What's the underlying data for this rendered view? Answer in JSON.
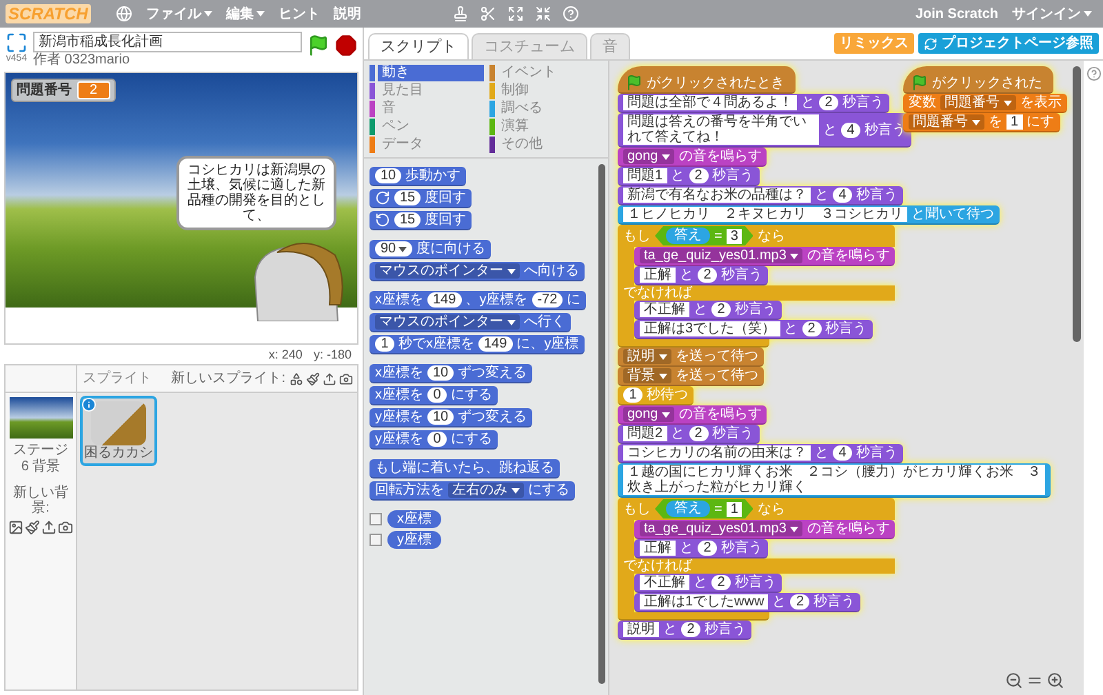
{
  "menu_bar": {
    "logo": "SCRATCH",
    "menus": [
      {
        "label": "ファイル",
        "dropdown": true
      },
      {
        "label": "編集",
        "dropdown": true
      },
      {
        "label": "ヒント",
        "dropdown": false
      },
      {
        "label": "説明",
        "dropdown": false
      }
    ],
    "join": "Join Scratch",
    "sign_in": "サインイン"
  },
  "project": {
    "version": "v454",
    "title": "新潟市稲成長化計画",
    "author": "作者 0323mario"
  },
  "stage": {
    "monitor": {
      "label": "問題番号",
      "value": "2"
    },
    "speech": "コシヒカリは新潟県の土壌、気候に適した新品種の開発を目的として、",
    "x_label": "x:",
    "x_value": "240",
    "y_label": "y:",
    "y_value": "-180"
  },
  "sprites": {
    "title": "スプライト",
    "new_sprite": "新しいスプライト:",
    "stage_label": "ステージ",
    "backdrops": "6 背景",
    "new_backdrop": "新しい背景:",
    "items": [
      {
        "name": "困るカカシ",
        "selected": true
      }
    ]
  },
  "tabs": [
    {
      "label": "スクリプト",
      "selected": true
    },
    {
      "label": "コスチューム",
      "selected": false
    },
    {
      "label": "音",
      "selected": false
    }
  ],
  "buttons": {
    "remix": "リミックス",
    "see_project": "プロジェクトページ参照"
  },
  "palette": {
    "categories": [
      {
        "label": "動き",
        "color": "#4a6cd4",
        "selected": true
      },
      {
        "label": "イベント",
        "color": "#c88330",
        "selected": false
      },
      {
        "label": "見た目",
        "color": "#8a55d7",
        "selected": false
      },
      {
        "label": "制御",
        "color": "#e1a91a",
        "selected": false
      },
      {
        "label": "音",
        "color": "#bb42c3",
        "selected": false
      },
      {
        "label": "調べる",
        "color": "#2ca5e2",
        "selected": false
      },
      {
        "label": "ペン",
        "color": "#0e9a6c",
        "selected": false
      },
      {
        "label": "演算",
        "color": "#5cb712",
        "selected": false
      },
      {
        "label": "データ",
        "color": "#ee7d16",
        "selected": false
      },
      {
        "label": "その他",
        "color": "#632d99",
        "selected": false
      }
    ],
    "groups": [
      [
        {
          "kind": "stack",
          "color": "#4a6cd4",
          "parts": [
            {
              "kind": "number",
              "text": "10"
            },
            {
              "kind": "label",
              "text": "歩動かす"
            }
          ]
        },
        {
          "kind": "stack",
          "color": "#4a6cd4",
          "parts": [
            {
              "kind": "rotate_right"
            },
            {
              "kind": "number",
              "text": "15"
            },
            {
              "kind": "label",
              "text": "度回す"
            }
          ]
        },
        {
          "kind": "stack",
          "color": "#4a6cd4",
          "parts": [
            {
              "kind": "rotate_left"
            },
            {
              "kind": "number",
              "text": "15"
            },
            {
              "kind": "label",
              "text": "度回す"
            }
          ]
        }
      ],
      [
        {
          "kind": "stack",
          "color": "#4a6cd4",
          "parts": [
            {
              "kind": "number_menu",
              "text": "90"
            },
            {
              "kind": "label",
              "text": "度に向ける"
            }
          ]
        },
        {
          "kind": "stack",
          "color": "#4a6cd4",
          "parts": [
            {
              "kind": "menu",
              "text": "マウスのポインター"
            },
            {
              "kind": "label",
              "text": "へ向ける"
            }
          ]
        }
      ],
      [
        {
          "kind": "stack",
          "color": "#4a6cd4",
          "parts": [
            {
              "kind": "label",
              "text": "x座標を"
            },
            {
              "kind": "number",
              "text": "149"
            },
            {
              "kind": "label",
              "text": "、y座標を"
            },
            {
              "kind": "number",
              "text": "-72"
            },
            {
              "kind": "label",
              "text": "に"
            }
          ]
        },
        {
          "kind": "stack",
          "color": "#4a6cd4",
          "parts": [
            {
              "kind": "menu",
              "text": "マウスのポインター"
            },
            {
              "kind": "label",
              "text": "へ行く"
            }
          ]
        },
        {
          "kind": "stack",
          "color": "#4a6cd4",
          "parts": [
            {
              "kind": "number",
              "text": "1"
            },
            {
              "kind": "label",
              "text": "秒でx座標を"
            },
            {
              "kind": "number",
              "text": "149"
            },
            {
              "kind": "label",
              "text": "に、y座標"
            }
          ]
        }
      ],
      [
        {
          "kind": "stack",
          "color": "#4a6cd4",
          "parts": [
            {
              "kind": "label",
              "text": "x座標を"
            },
            {
              "kind": "number",
              "text": "10"
            },
            {
              "kind": "label",
              "text": "ずつ変える"
            }
          ]
        },
        {
          "kind": "stack",
          "color": "#4a6cd4",
          "parts": [
            {
              "kind": "label",
              "text": "x座標を"
            },
            {
              "kind": "number",
              "text": "0"
            },
            {
              "kind": "label",
              "text": "にする"
            }
          ]
        },
        {
          "kind": "stack",
          "color": "#4a6cd4",
          "parts": [
            {
              "kind": "label",
              "text": "y座標を"
            },
            {
              "kind": "number",
              "text": "10"
            },
            {
              "kind": "label",
              "text": "ずつ変える"
            }
          ]
        },
        {
          "kind": "stack",
          "color": "#4a6cd4",
          "parts": [
            {
              "kind": "label",
              "text": "y座標を"
            },
            {
              "kind": "number",
              "text": "0"
            },
            {
              "kind": "label",
              "text": "にする"
            }
          ]
        }
      ],
      [
        {
          "kind": "stack",
          "color": "#4a6cd4",
          "parts": [
            {
              "kind": "label",
              "text": "もし端に着いたら、跳ね返る"
            }
          ]
        },
        {
          "kind": "stack",
          "color": "#4a6cd4",
          "parts": [
            {
              "kind": "label",
              "text": "回転方法を"
            },
            {
              "kind": "menu",
              "text": "左右のみ"
            },
            {
              "kind": "label",
              "text": "にする"
            }
          ]
        }
      ],
      [
        {
          "kind": "reporter",
          "color": "#4a6cd4",
          "checked": false,
          "parts": [
            {
              "kind": "label",
              "text": "x座標"
            }
          ]
        },
        {
          "kind": "reporter",
          "color": "#4a6cd4",
          "checked": false,
          "parts": [
            {
              "kind": "label",
              "text": "y座標"
            }
          ]
        }
      ]
    ]
  },
  "scripts": [
    {
      "running": true,
      "blocks": [
        {
          "kind": "hat",
          "color": "#c88330",
          "parts": [
            {
              "kind": "flag"
            },
            {
              "kind": "label",
              "text": "がクリックされたとき"
            }
          ]
        },
        {
          "kind": "stack",
          "color": "#8a55d7",
          "parts": [
            {
              "kind": "input",
              "text": "問題は全部で４問あるよ！"
            },
            {
              "kind": "label",
              "text": "と"
            },
            {
              "kind": "number",
              "text": "2"
            },
            {
              "kind": "label",
              "text": "秒言う"
            }
          ]
        },
        {
          "kind": "stack",
          "color": "#8a55d7",
          "parts": [
            {
              "kind": "input",
              "text": "問題は答えの番号を半角でいれて答えてね！"
            },
            {
              "kind": "label",
              "text": "と"
            },
            {
              "kind": "number",
              "text": "4"
            },
            {
              "kind": "label",
              "text": "秒言う"
            }
          ]
        },
        {
          "kind": "stack",
          "color": "#bb42c3",
          "parts": [
            {
              "kind": "menu",
              "text": "gong"
            },
            {
              "kind": "label",
              "text": "の音を鳴らす"
            }
          ]
        },
        {
          "kind": "stack",
          "color": "#8a55d7",
          "parts": [
            {
              "kind": "input",
              "text": "問題1"
            },
            {
              "kind": "label",
              "text": "と"
            },
            {
              "kind": "number",
              "text": "2"
            },
            {
              "kind": "label",
              "text": "秒言う"
            }
          ]
        },
        {
          "kind": "stack",
          "color": "#8a55d7",
          "parts": [
            {
              "kind": "input",
              "text": "新潟で有名なお米の品種は？"
            },
            {
              "kind": "label",
              "text": "と"
            },
            {
              "kind": "number",
              "text": "4"
            },
            {
              "kind": "label",
              "text": "秒言う"
            }
          ]
        },
        {
          "kind": "ask",
          "color": "#2ca5e2",
          "parts": [
            {
              "kind": "input",
              "text": "１ヒノヒカリ　２キヌヒカリ　３コシヒカリ"
            },
            {
              "kind": "label",
              "text": "と聞いて待つ"
            }
          ]
        },
        {
          "kind": "if_else",
          "color": "#e1a91a",
          "parts": [
            {
              "kind": "label",
              "text": "もし"
            },
            {
              "kind": "boolean",
              "color": "#5cb712",
              "parts": [
                {
                  "kind": "reporter",
                  "color": "#2ca5e2",
                  "text": "答え"
                },
                {
                  "kind": "label",
                  "text": "="
                },
                {
                  "kind": "input",
                  "text": "3"
                }
              ]
            },
            {
              "kind": "label",
              "text": "なら"
            }
          ],
          "children": [
            {
              "kind": "stack",
              "color": "#bb42c3",
              "parts": [
                {
                  "kind": "menu",
                  "text": "ta_ge_quiz_yes01.mp3"
                },
                {
                  "kind": "label",
                  "text": "の音を鳴らす"
                }
              ]
            },
            {
              "kind": "stack",
              "color": "#8a55d7",
              "parts": [
                {
                  "kind": "input",
                  "text": "正解"
                },
                {
                  "kind": "label",
                  "text": "と"
                },
                {
                  "kind": "number",
                  "text": "2"
                },
                {
                  "kind": "label",
                  "text": "秒言う"
                }
              ]
            }
          ],
          "else_label": "でなければ",
          "else_children": [
            {
              "kind": "stack",
              "color": "#8a55d7",
              "parts": [
                {
                  "kind": "input",
                  "text": "不正解"
                },
                {
                  "kind": "label",
                  "text": "と"
                },
                {
                  "kind": "number",
                  "text": "2"
                },
                {
                  "kind": "label",
                  "text": "秒言う"
                }
              ]
            },
            {
              "kind": "stack",
              "color": "#8a55d7",
              "parts": [
                {
                  "kind": "input",
                  "text": "正解は3でした（笑）"
                },
                {
                  "kind": "label",
                  "text": "と"
                },
                {
                  "kind": "number",
                  "text": "2"
                },
                {
                  "kind": "label",
                  "text": "秒言う"
                }
              ]
            }
          ]
        },
        {
          "kind": "stack",
          "color": "#c88330",
          "parts": [
            {
              "kind": "menu",
              "text": "説明"
            },
            {
              "kind": "label",
              "text": "を送って待つ"
            }
          ]
        },
        {
          "kind": "stack",
          "color": "#c88330",
          "parts": [
            {
              "kind": "menu",
              "text": "背景"
            },
            {
              "kind": "label",
              "text": "を送って待つ"
            }
          ]
        },
        {
          "kind": "stack",
          "color": "#e1a91a",
          "parts": [
            {
              "kind": "number",
              "text": "1"
            },
            {
              "kind": "label",
              "text": "秒待つ"
            }
          ]
        },
        {
          "kind": "stack",
          "color": "#bb42c3",
          "parts": [
            {
              "kind": "menu",
              "text": "gong"
            },
            {
              "kind": "label",
              "text": "の音を鳴らす"
            }
          ]
        },
        {
          "kind": "stack",
          "color": "#8a55d7",
          "parts": [
            {
              "kind": "input",
              "text": "問題2"
            },
            {
              "kind": "label",
              "text": "と"
            },
            {
              "kind": "number",
              "text": "2"
            },
            {
              "kind": "label",
              "text": "秒言う"
            }
          ]
        },
        {
          "kind": "stack",
          "color": "#8a55d7",
          "parts": [
            {
              "kind": "input",
              "text": "コシヒカリの名前の由来は？"
            },
            {
              "kind": "label",
              "text": "と"
            },
            {
              "kind": "number",
              "text": "4"
            },
            {
              "kind": "label",
              "text": "秒言う"
            }
          ]
        },
        {
          "kind": "ask",
          "color": "#2ca5e2",
          "parts": [
            {
              "kind": "input",
              "text": "１越の国にヒカリ輝くお米　２コシ（腰力）がヒカリ輝くお米　３炊き上がった粒がヒカリ輝く"
            }
          ]
        },
        {
          "kind": "if_else",
          "color": "#e1a91a",
          "parts": [
            {
              "kind": "label",
              "text": "もし"
            },
            {
              "kind": "boolean",
              "color": "#5cb712",
              "parts": [
                {
                  "kind": "reporter",
                  "color": "#2ca5e2",
                  "text": "答え"
                },
                {
                  "kind": "label",
                  "text": "="
                },
                {
                  "kind": "input",
                  "text": "1"
                }
              ]
            },
            {
              "kind": "label",
              "text": "なら"
            }
          ],
          "children": [
            {
              "kind": "stack",
              "color": "#bb42c3",
              "parts": [
                {
                  "kind": "menu",
                  "text": "ta_ge_quiz_yes01.mp3"
                },
                {
                  "kind": "label",
                  "text": "の音を鳴らす"
                }
              ]
            },
            {
              "kind": "stack",
              "color": "#8a55d7",
              "parts": [
                {
                  "kind": "input",
                  "text": "正解"
                },
                {
                  "kind": "label",
                  "text": "と"
                },
                {
                  "kind": "number",
                  "text": "2"
                },
                {
                  "kind": "label",
                  "text": "秒言う"
                }
              ]
            }
          ],
          "else_label": "でなければ",
          "else_children": [
            {
              "kind": "stack",
              "color": "#8a55d7",
              "parts": [
                {
                  "kind": "input",
                  "text": "不正解"
                },
                {
                  "kind": "label",
                  "text": "と"
                },
                {
                  "kind": "number",
                  "text": "2"
                },
                {
                  "kind": "label",
                  "text": "秒言う"
                }
              ]
            },
            {
              "kind": "stack",
              "color": "#8a55d7",
              "parts": [
                {
                  "kind": "input",
                  "text": "正解は1でしたwww"
                },
                {
                  "kind": "label",
                  "text": "と"
                },
                {
                  "kind": "number",
                  "text": "2"
                },
                {
                  "kind": "label",
                  "text": "秒言う"
                }
              ]
            }
          ]
        },
        {
          "kind": "stack",
          "color": "#8a55d7",
          "parts": [
            {
              "kind": "input",
              "text": "説明"
            },
            {
              "kind": "label",
              "text": "と"
            },
            {
              "kind": "number",
              "text": "2"
            },
            {
              "kind": "label",
              "text": "秒言う"
            }
          ]
        }
      ]
    },
    {
      "running": true,
      "blocks": [
        {
          "kind": "hat",
          "color": "#c88330",
          "parts": [
            {
              "kind": "flag"
            },
            {
              "kind": "label",
              "text": "がクリックされた"
            }
          ]
        },
        {
          "kind": "stack",
          "color": "#ee7d16",
          "parts": [
            {
              "kind": "label",
              "text": "変数"
            },
            {
              "kind": "menu",
              "text": "問題番号"
            },
            {
              "kind": "label",
              "text": "を表示"
            }
          ]
        },
        {
          "kind": "stack",
          "color": "#ee7d16",
          "parts": [
            {
              "kind": "menu",
              "text": "問題番号"
            },
            {
              "kind": "label",
              "text": "を"
            },
            {
              "kind": "input",
              "text": "1"
            },
            {
              "kind": "label",
              "text": "にす"
            }
          ]
        }
      ]
    }
  ]
}
